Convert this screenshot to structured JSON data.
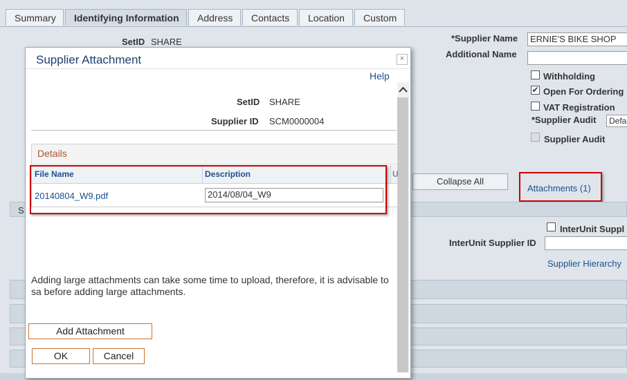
{
  "tabs": [
    {
      "label": "Summary",
      "active": false
    },
    {
      "label": "Identifying Information",
      "active": true
    },
    {
      "label": "Address",
      "active": false
    },
    {
      "label": "Contacts",
      "active": false
    },
    {
      "label": "Location",
      "active": false
    },
    {
      "label": "Custom",
      "active": false
    }
  ],
  "background": {
    "setid_label": "SetID",
    "setid_value": "SHARE",
    "supplier_name_label": "*Supplier Name",
    "supplier_name_value": "ERNIE'S BIKE SHOP",
    "additional_name_label": "Additional Name",
    "additional_name_value": "",
    "withholding_label": "Withholding",
    "open_for_ordering_label": "Open For Ordering",
    "vat_registration_label": "VAT Registration",
    "supplier_audit_req_label": "*Supplier Audit",
    "supplier_audit_select": "Defa",
    "supplier_audit_label": "Supplier Audit",
    "collapse_all_label": "Collapse All",
    "attachments_link": "Attachments (1)",
    "interunit_supplier_label": "InterUnit Suppl",
    "interunit_supplier_id_label": "InterUnit Supplier ID",
    "supplier_hierarchy_link": "Supplier Hierarchy",
    "section_letter": "S"
  },
  "modal": {
    "title": "Supplier Attachment",
    "close_glyph": "×",
    "help_link": "Help",
    "setid_label": "SetID",
    "setid_value": "SHARE",
    "supplier_id_label": "Supplier ID",
    "supplier_id_value": "SCM0000004",
    "details_title": "Details",
    "columns": [
      "File Name",
      "Description",
      "U"
    ],
    "rows": [
      {
        "file_name": "20140804_W9.pdf",
        "description": "2014/08/04_W9"
      }
    ],
    "notice": "Adding large attachments can take some time to upload, therefore, it is advisable to sa before adding large attachments.",
    "add_attachment_label": "Add Attachment",
    "ok_label": "OK",
    "cancel_label": "Cancel"
  }
}
